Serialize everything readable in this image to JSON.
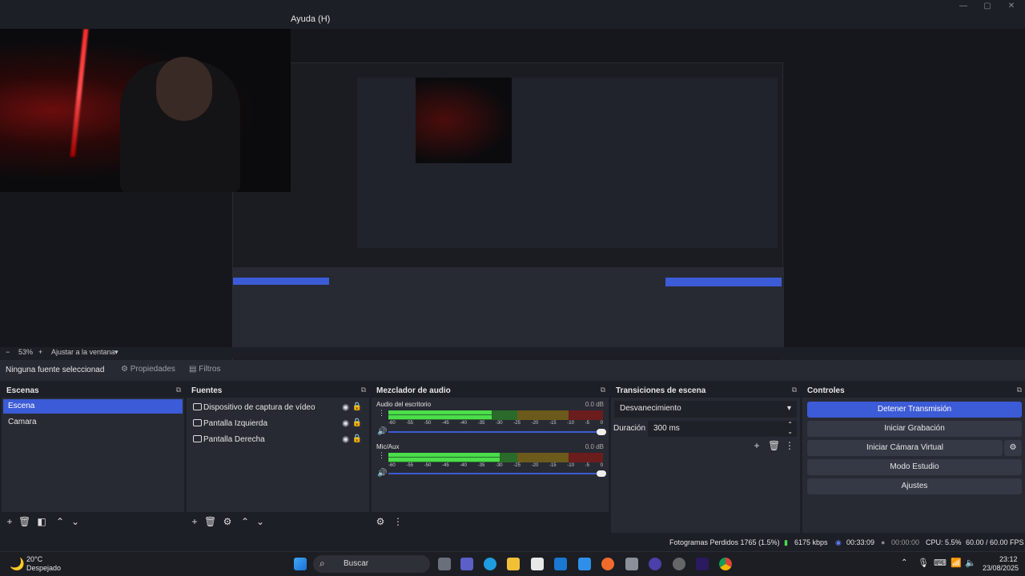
{
  "menu": {
    "help": "Ayuda (H)"
  },
  "window_controls": {
    "minimize": "—",
    "maximize": "▢",
    "close": "✕"
  },
  "zoom": {
    "minus": "−",
    "value": "53%",
    "plus": "+",
    "fit": "Ajustar a la ventana",
    "dropdown": "▾"
  },
  "source_bar": {
    "none": "Ninguna fuente seleccionad",
    "properties": "Propiedades",
    "filters": "Filtros"
  },
  "scenes": {
    "title": "Escenas",
    "items": [
      {
        "label": "Escena",
        "selected": true
      },
      {
        "label": "Camara",
        "selected": false
      }
    ]
  },
  "sources": {
    "title": "Fuentes",
    "items": [
      {
        "label": "Dispositivo de captura de vídeo",
        "icon": "camera-icon"
      },
      {
        "label": "Pantalla Izquierda",
        "icon": "monitor-icon"
      },
      {
        "label": "Pantalla Derecha",
        "icon": "monitor-icon"
      }
    ]
  },
  "mixer": {
    "title": "Mezclador de audio",
    "channels": [
      {
        "name": "Audio del escritorio",
        "db": "0.0 dB",
        "level": 0.48
      },
      {
        "name": "Mic/Aux",
        "db": "0.0 dB",
        "level": 0.52
      }
    ],
    "ticks": [
      "-60",
      "-55",
      "-50",
      "-45",
      "-40",
      "-35",
      "-30",
      "-25",
      "-20",
      "-15",
      "-10",
      "-5",
      "0"
    ]
  },
  "transitions": {
    "title": "Transiciones de escena",
    "selected": "Desvanecimiento",
    "duration_label": "Duración",
    "duration_value": "300 ms"
  },
  "controls": {
    "title": "Controles",
    "buttons": {
      "stop_stream": "Detener Transmisión",
      "start_recording": "Iniciar Grabación",
      "start_virtual_cam": "Iniciar Cámara Virtual",
      "studio_mode": "Modo Estudio",
      "settings": "Ajustes"
    }
  },
  "status": {
    "dropped": "Fotogramas Perdidos 1765 (1.5%)",
    "bitrate": "6175 kbps",
    "stream_time": "00:33:09",
    "rec_time": "00:00:00",
    "cpu": "CPU: 5.5%",
    "fps": "60.00 / 60.00 FPS"
  },
  "taskbar": {
    "weather_temp": "20°C",
    "weather_desc": "Despejado",
    "search": "Buscar",
    "time": "23:12",
    "date": "23/08/2025"
  },
  "colors": {
    "accent": "#3c5bd6",
    "panel": "#272a33",
    "background": "#1d1f26"
  }
}
